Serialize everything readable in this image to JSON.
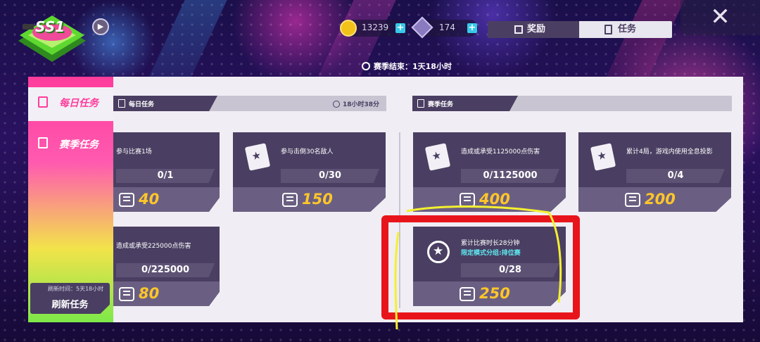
{
  "top": {
    "logo_text": "SS1",
    "coins": "13239",
    "gems": "174",
    "season_end": "赛季结束：1天18小时",
    "colors": {
      "coin": "#f2c21a",
      "gem": "#8a7ac0",
      "plus": "#38c8e8"
    }
  },
  "tabs": {
    "rewards": "奖励",
    "tasks": "任务"
  },
  "sidebar": {
    "daily": "每日任务",
    "season": "赛季任务",
    "refresh_time": "刷新时间：5天18小时",
    "refresh_button": "刷新任务"
  },
  "daily_section": {
    "title": "每日任务",
    "timer": "18小时38分"
  },
  "season_section": {
    "title": "赛季任务"
  },
  "daily_cards": [
    {
      "title": "参与比赛1场",
      "progress": "0/1",
      "fill": 0,
      "reward": "40"
    },
    {
      "title": "参与击倒30名敌人",
      "progress": "0/30",
      "fill": 0,
      "reward": "150"
    },
    {
      "title": "造成或承受225000点伤害",
      "progress": "0/225000",
      "fill": 0,
      "reward": "80"
    }
  ],
  "season_cards": [
    {
      "title": "造成或承受1125000点伤害",
      "progress": "0/1125000",
      "fill": 0,
      "reward": "400"
    },
    {
      "title": "累计4局，游戏内使用全息投影",
      "progress": "0/4",
      "fill": 0,
      "reward": "200"
    },
    {
      "title": "累计比赛时长28分钟",
      "subtitle": "限定模式分组:排位赛",
      "progress": "0/28",
      "fill": 0,
      "reward": "250"
    }
  ],
  "accent": {
    "highlight": "#e8141c",
    "reward_text": "#ffc62a",
    "card": "#4a3f62"
  }
}
